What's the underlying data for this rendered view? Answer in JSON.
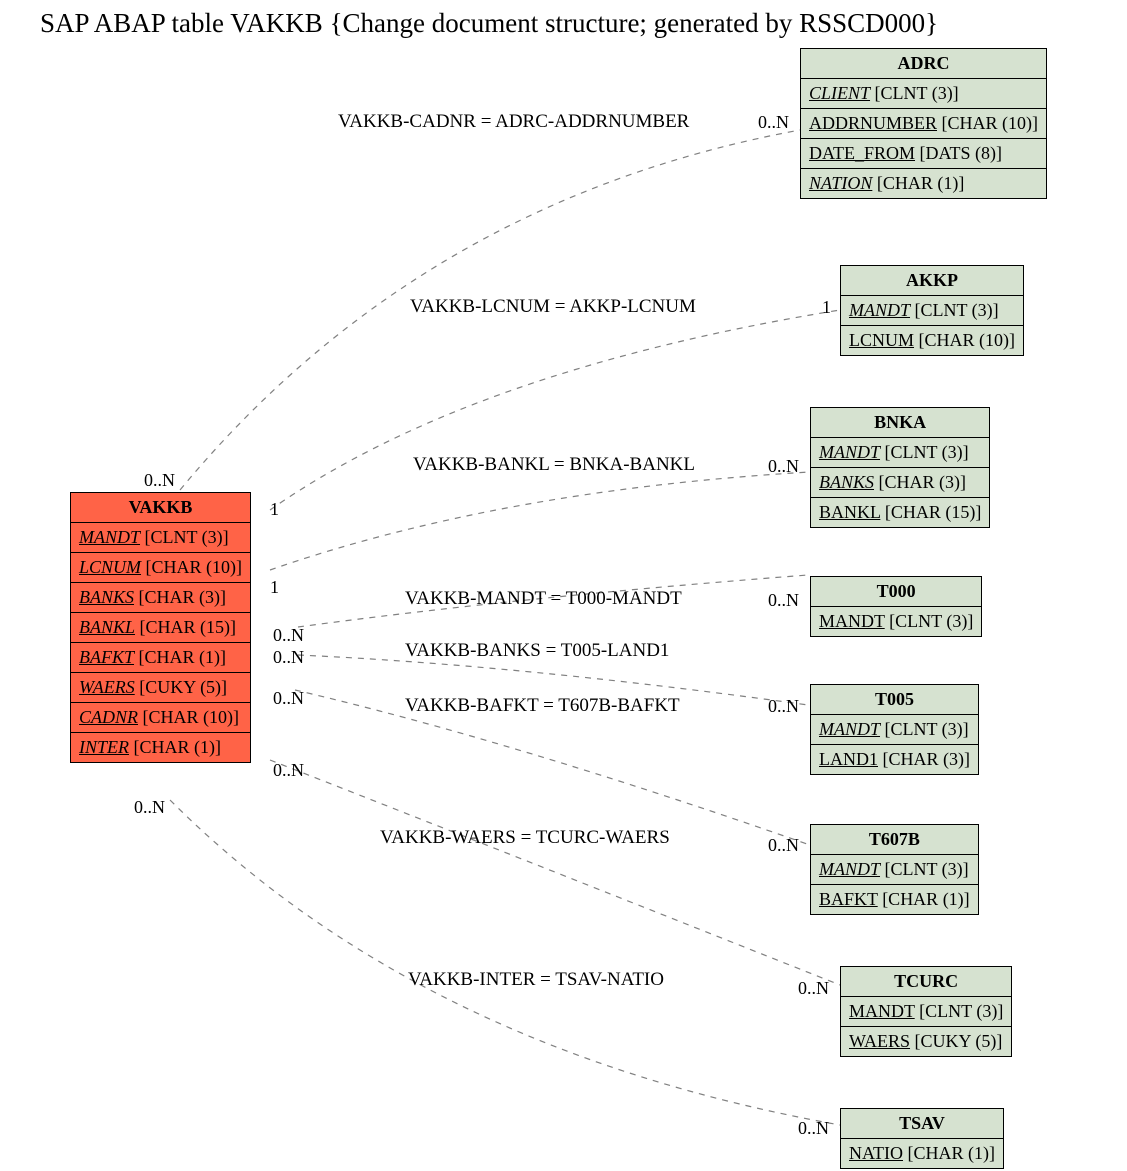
{
  "title": "SAP ABAP table VAKKB {Change document structure; generated by RSSCD000}",
  "source": {
    "name": "VAKKB",
    "fields": [
      {
        "k": "MANDT",
        "t": "[CLNT (3)]"
      },
      {
        "k": "LCNUM",
        "t": "[CHAR (10)]"
      },
      {
        "k": "BANKS",
        "t": "[CHAR (3)]"
      },
      {
        "k": "BANKL",
        "t": "[CHAR (15)]"
      },
      {
        "k": "BAFKT",
        "t": "[CHAR (1)]"
      },
      {
        "k": "WAERS",
        "t": "[CUKY (5)]"
      },
      {
        "k": "CADNR",
        "t": "[CHAR (10)]"
      },
      {
        "k": "INTER",
        "t": "[CHAR (1)]"
      }
    ]
  },
  "targets": [
    {
      "name": "ADRC",
      "fields": [
        {
          "k": "CLIENT",
          "t": "[CLNT (3)]",
          "key": true
        },
        {
          "k": "ADDRNUMBER",
          "t": "[CHAR (10)]",
          "key": false
        },
        {
          "k": "DATE_FROM",
          "t": "[DATS (8)]",
          "key": false
        },
        {
          "k": "NATION",
          "t": "[CHAR (1)]",
          "key": true
        }
      ],
      "rel": "VAKKB-CADNR = ADRC-ADDRNUMBER",
      "srcCard": "0..N",
      "tgtCard": "0..N"
    },
    {
      "name": "AKKP",
      "fields": [
        {
          "k": "MANDT",
          "t": "[CLNT (3)]",
          "key": true
        },
        {
          "k": "LCNUM",
          "t": "[CHAR (10)]",
          "key": false
        }
      ],
      "rel": "VAKKB-LCNUM = AKKP-LCNUM",
      "srcCard": "1",
      "tgtCard": "1"
    },
    {
      "name": "BNKA",
      "fields": [
        {
          "k": "MANDT",
          "t": "[CLNT (3)]",
          "key": true
        },
        {
          "k": "BANKS",
          "t": "[CHAR (3)]",
          "key": true
        },
        {
          "k": "BANKL",
          "t": "[CHAR (15)]",
          "key": false
        }
      ],
      "rel": "VAKKB-BANKL = BNKA-BANKL",
      "srcCard": "1",
      "tgtCard": "0..N"
    },
    {
      "name": "T000",
      "fields": [
        {
          "k": "MANDT",
          "t": "[CLNT (3)]",
          "key": false
        }
      ],
      "rel": "VAKKB-MANDT = T000-MANDT",
      "srcCard": "0..N",
      "tgtCard": "0..N"
    },
    {
      "name": "T005",
      "fields": [
        {
          "k": "MANDT",
          "t": "[CLNT (3)]",
          "key": true
        },
        {
          "k": "LAND1",
          "t": "[CHAR (3)]",
          "key": false
        }
      ],
      "rel": "VAKKB-BANKS = T005-LAND1",
      "srcCard": "0..N",
      "tgtCard": "0..N"
    },
    {
      "name": "T607B",
      "fields": [
        {
          "k": "MANDT",
          "t": "[CLNT (3)]",
          "key": true
        },
        {
          "k": "BAFKT",
          "t": "[CHAR (1)]",
          "key": false
        }
      ],
      "rel": "VAKKB-BAFKT = T607B-BAFKT",
      "srcCard": "0..N",
      "tgtCard": "0..N"
    },
    {
      "name": "TCURC",
      "fields": [
        {
          "k": "MANDT",
          "t": "[CLNT (3)]",
          "key": false
        },
        {
          "k": "WAERS",
          "t": "[CUKY (5)]",
          "key": false
        }
      ],
      "rel": "VAKKB-WAERS = TCURC-WAERS",
      "srcCard": "0..N",
      "tgtCard": "0..N"
    },
    {
      "name": "TSAV",
      "fields": [
        {
          "k": "NATIO",
          "t": "[CHAR (1)]",
          "key": false
        }
      ],
      "rel": "VAKKB-INTER = TSAV-NATIO",
      "srcCard": "0..N",
      "tgtCard": "0..N"
    }
  ]
}
